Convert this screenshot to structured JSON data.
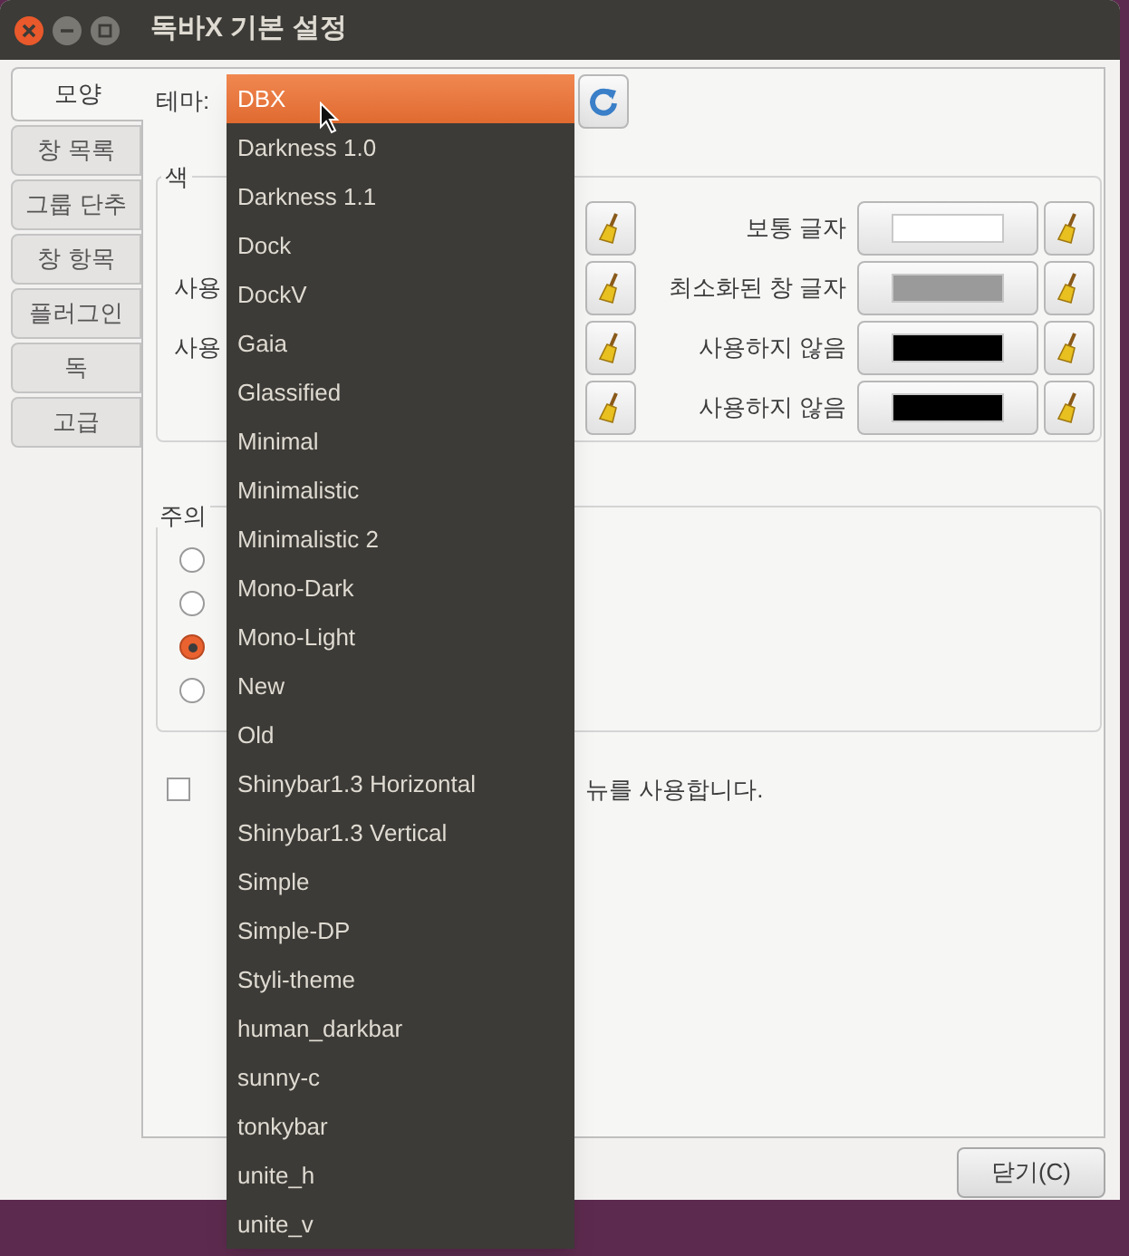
{
  "window": {
    "title": "독바X 기본 설정"
  },
  "tabs": [
    {
      "label": "모양",
      "selected": true
    },
    {
      "label": "창 목록",
      "selected": false
    },
    {
      "label": "그룹 단추",
      "selected": false
    },
    {
      "label": "창 항목",
      "selected": false
    },
    {
      "label": "플러그인",
      "selected": false
    },
    {
      "label": "독",
      "selected": false
    },
    {
      "label": "고급",
      "selected": false
    }
  ],
  "theme_label": "테마:",
  "theme_menu": [
    {
      "label": "DBX",
      "selected": true
    },
    {
      "label": "Darkness 1.0",
      "selected": false
    },
    {
      "label": "Darkness 1.1",
      "selected": false
    },
    {
      "label": "Dock",
      "selected": false
    },
    {
      "label": "DockV",
      "selected": false
    },
    {
      "label": "Gaia",
      "selected": false
    },
    {
      "label": "Glassified",
      "selected": false
    },
    {
      "label": "Minimal",
      "selected": false
    },
    {
      "label": "Minimalistic",
      "selected": false
    },
    {
      "label": "Minimalistic 2",
      "selected": false
    },
    {
      "label": "Mono-Dark",
      "selected": false
    },
    {
      "label": "Mono-Light",
      "selected": false
    },
    {
      "label": "New",
      "selected": false
    },
    {
      "label": "Old",
      "selected": false
    },
    {
      "label": "Shinybar1.3 Horizontal",
      "selected": false
    },
    {
      "label": "Shinybar1.3 Vertical",
      "selected": false
    },
    {
      "label": "Simple",
      "selected": false
    },
    {
      "label": "Simple-DP",
      "selected": false
    },
    {
      "label": "Styli-theme",
      "selected": false
    },
    {
      "label": "human_darkbar",
      "selected": false
    },
    {
      "label": "sunny-c",
      "selected": false
    },
    {
      "label": "tonkybar",
      "selected": false
    },
    {
      "label": "unite_h",
      "selected": false
    },
    {
      "label": "unite_v",
      "selected": false
    }
  ],
  "colors": {
    "title": "색",
    "left_rows": [
      {},
      {
        "label": "사용"
      },
      {
        "label": "사용"
      },
      {}
    ],
    "right_rows": [
      {
        "label": "보통 글자",
        "color": "#ffffff"
      },
      {
        "label": "최소화된 창 글자",
        "color": "#9a9a9a"
      },
      {
        "label": "사용하지 않음",
        "color": "#000000"
      },
      {
        "label": "사용하지 않음",
        "color": "#000000"
      }
    ]
  },
  "attention": {
    "title": "주의",
    "options": [
      {
        "selected": false
      },
      {
        "selected": false
      },
      {
        "selected": true
      },
      {
        "selected": false
      }
    ]
  },
  "checkbox": {
    "label": "뉴를 사용합니다.",
    "checked": false
  },
  "close_button": "닫기(C)"
}
